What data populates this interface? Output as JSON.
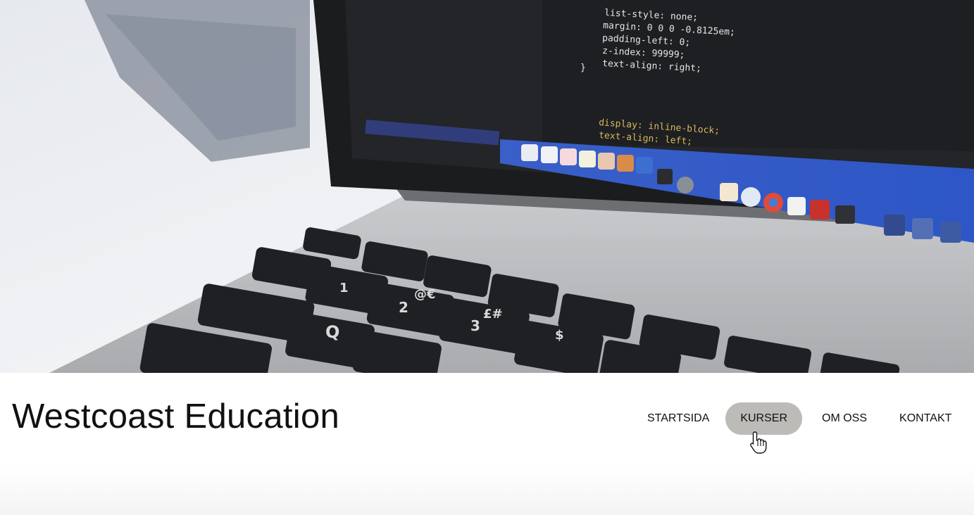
{
  "site": {
    "title": "Westcoast Education"
  },
  "nav": {
    "items": [
      {
        "label": "STARTSIDA",
        "active": false
      },
      {
        "label": "KURSER",
        "active": true
      },
      {
        "label": "OM OSS",
        "active": false
      },
      {
        "label": "KONTAKT",
        "active": false
      }
    ]
  },
  "hero": {
    "code_lines": [
      "list-style: none;",
      "margin: 0 0 0 -0.8125em;",
      "padding-left: 0;",
      "z-index: 99999;",
      "text-align: right;",
      "}",
      "display: inline-block;",
      "text-align: left;"
    ]
  },
  "colors": {
    "active_nav_bg": "#bdbbb8",
    "text": "#111111"
  }
}
